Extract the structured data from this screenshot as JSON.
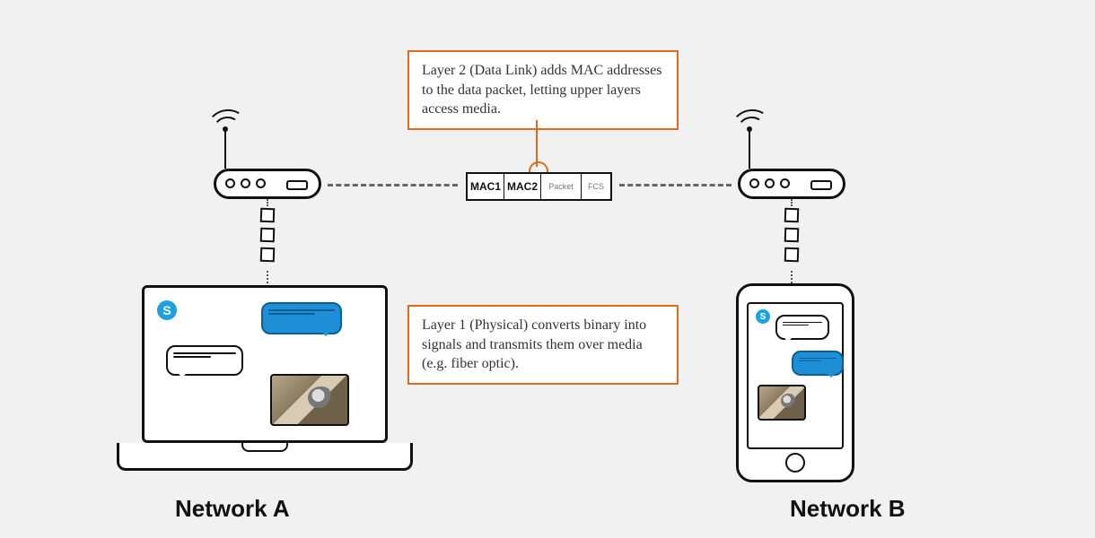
{
  "networks": {
    "a": "Network A",
    "b": "Network B"
  },
  "callouts": {
    "layer2": "Layer 2 (Data Link) adds MAC addresses to the data packet, letting upper layers access media.",
    "layer1": "Layer 1 (Physical) converts binary into signals and transmits them over media (e.g. fiber optic)."
  },
  "frame": {
    "segments": [
      "MAC1",
      "MAC2",
      "Packet",
      "FCS"
    ]
  },
  "icons": {
    "skype_glyph": "S"
  },
  "colors": {
    "accent": "#e06a1d",
    "bubble_blue": "#1e8fd6"
  }
}
